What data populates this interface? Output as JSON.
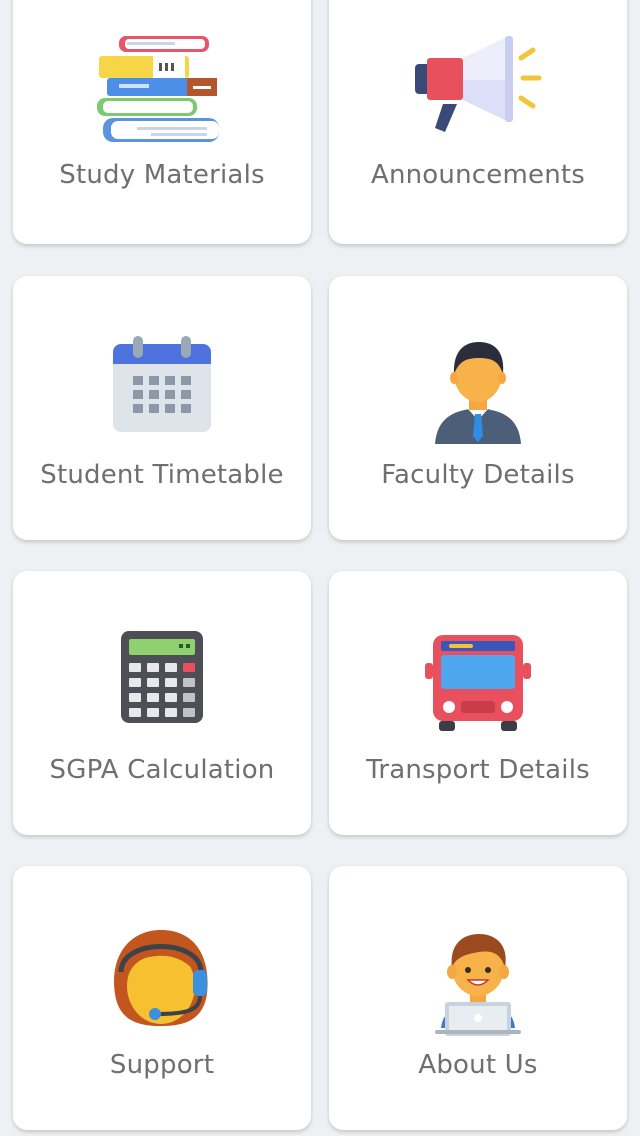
{
  "tiles": [
    {
      "label": "Study Materials",
      "icon": "books-icon"
    },
    {
      "label": "Announcements",
      "icon": "megaphone-icon"
    },
    {
      "label": "Student Timetable",
      "icon": "calendar-icon"
    },
    {
      "label": "Faculty Details",
      "icon": "faculty-person-icon"
    },
    {
      "label": "SGPA Calculation",
      "icon": "calculator-icon"
    },
    {
      "label": "Transport Details",
      "icon": "bus-icon"
    },
    {
      "label": "Support",
      "icon": "support-headset-icon"
    },
    {
      "label": "About Us",
      "icon": "about-person-laptop-icon"
    }
  ]
}
